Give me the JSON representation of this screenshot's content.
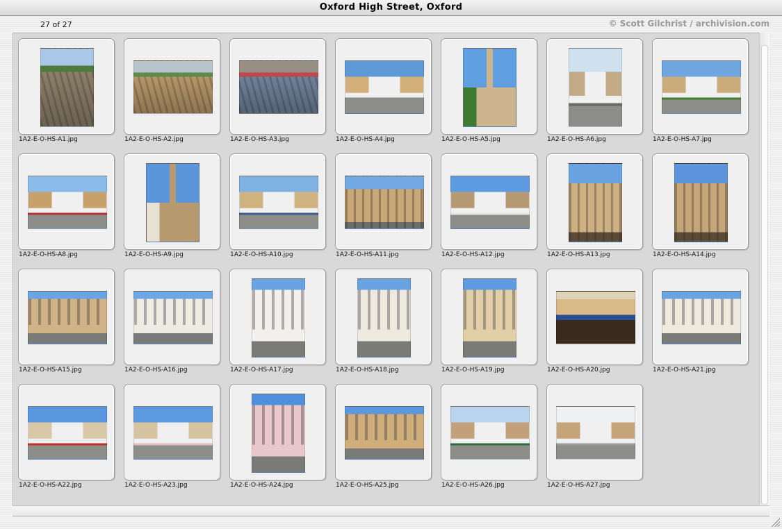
{
  "window": {
    "title": "Oxford High Street, Oxford"
  },
  "header": {
    "count": "27 of 27",
    "credit": "© Scott Gilchrist / archivision.com"
  },
  "images": [
    {
      "file": "1A2-E-O-HS-A1.jpg",
      "orientation": "p",
      "scene": "aerial-street",
      "sky": "#a9c7e6",
      "main": "#9a8c74",
      "accent": "#4f7a3c"
    },
    {
      "file": "1A2-E-O-HS-A2.jpg",
      "orientation": "l",
      "scene": "aerial-roofs",
      "sky": "#b8c4cc",
      "main": "#c9a673",
      "accent": "#5b8a49"
    },
    {
      "file": "1A2-E-O-HS-A3.jpg",
      "orientation": "l",
      "scene": "aerial-roofs",
      "sky": "#9a8f85",
      "main": "#7a8fa8",
      "accent": "#c0464a"
    },
    {
      "file": "1A2-E-O-HS-A4.jpg",
      "orientation": "l",
      "scene": "street",
      "sky": "#5e9ad8",
      "main": "#d3b07a",
      "accent": "#8a8a86"
    },
    {
      "file": "1A2-E-O-HS-A5.jpg",
      "orientation": "p",
      "scene": "spire",
      "sky": "#5f9fe0",
      "main": "#cbb48e",
      "accent": "#3f7a32"
    },
    {
      "file": "1A2-E-O-HS-A6.jpg",
      "orientation": "p",
      "scene": "street",
      "sky": "#cfe0ef",
      "main": "#c2ab86",
      "accent": "#6e6e6c"
    },
    {
      "file": "1A2-E-O-HS-A7.jpg",
      "orientation": "l",
      "scene": "street",
      "sky": "#6fa6df",
      "main": "#c9ab7c",
      "accent": "#3f7d2f"
    },
    {
      "file": "1A2-E-O-HS-A8.jpg",
      "orientation": "l",
      "scene": "street",
      "sky": "#8bbbe8",
      "main": "#c7a06b",
      "accent": "#b8323a"
    },
    {
      "file": "1A2-E-O-HS-A9.jpg",
      "orientation": "p",
      "scene": "spire",
      "sky": "#5b95da",
      "main": "#b89a70",
      "accent": "#e8e2d5"
    },
    {
      "file": "1A2-E-O-HS-A10.jpg",
      "orientation": "l",
      "scene": "street",
      "sky": "#7fb1e3",
      "main": "#cfb27f",
      "accent": "#3a5f8a"
    },
    {
      "file": "1A2-E-O-HS-A11.jpg",
      "orientation": "l",
      "scene": "building",
      "sky": "#72a9e2",
      "main": "#c8a877",
      "accent": "#6d6d6a"
    },
    {
      "file": "1A2-E-O-HS-A12.jpg",
      "orientation": "l",
      "scene": "street",
      "sky": "#5e9be0",
      "main": "#b59a73",
      "accent": "#e6e6e3"
    },
    {
      "file": "1A2-E-O-HS-A13.jpg",
      "orientation": "p",
      "scene": "building",
      "sky": "#6aa3e1",
      "main": "#cdb084",
      "accent": "#5a4a36"
    },
    {
      "file": "1A2-E-O-HS-A14.jpg",
      "orientation": "p",
      "scene": "building",
      "sky": "#5c95dc",
      "main": "#c4a67a",
      "accent": "#5a4a36"
    },
    {
      "file": "1A2-E-O-HS-A15.jpg",
      "orientation": "l",
      "scene": "facade",
      "sky": "#6aa5e3",
      "main": "#d0b386",
      "accent": "#8a8b87"
    },
    {
      "file": "1A2-E-O-HS-A16.jpg",
      "orientation": "l",
      "scene": "facade",
      "sky": "#6ea8e4",
      "main": "#efece4",
      "accent": "#c9a56c"
    },
    {
      "file": "1A2-E-O-HS-A17.jpg",
      "orientation": "p",
      "scene": "facade",
      "sky": "#6aa3e2",
      "main": "#f2f0ea",
      "accent": "#d4a03a"
    },
    {
      "file": "1A2-E-O-HS-A18.jpg",
      "orientation": "p",
      "scene": "facade",
      "sky": "#6aa3e2",
      "main": "#eeeae0",
      "accent": "#2f3a2c"
    },
    {
      "file": "1A2-E-O-HS-A19.jpg",
      "orientation": "p",
      "scene": "facade",
      "sky": "#5f9be0",
      "main": "#e2cfa8",
      "accent": "#2d4a86"
    },
    {
      "file": "1A2-E-O-HS-A20.jpg",
      "orientation": "l",
      "scene": "market",
      "sky": "#e0d4b8",
      "main": "#d8b988",
      "accent": "#2b4f94"
    },
    {
      "file": "1A2-E-O-HS-A21.jpg",
      "orientation": "l",
      "scene": "facade",
      "sky": "#69a4e3",
      "main": "#efe9de",
      "accent": "#b8323a"
    },
    {
      "file": "1A2-E-O-HS-A22.jpg",
      "orientation": "l",
      "scene": "street",
      "sky": "#5a97de",
      "main": "#d9c8a8",
      "accent": "#c0302c"
    },
    {
      "file": "1A2-E-O-HS-A23.jpg",
      "orientation": "l",
      "scene": "street",
      "sky": "#5e9ae0",
      "main": "#d6c3a0",
      "accent": "#e7b8c0"
    },
    {
      "file": "1A2-E-O-HS-A24.jpg",
      "orientation": "p",
      "scene": "facade",
      "sky": "#4f8fdc",
      "main": "#e9c8cc",
      "accent": "#7a8d9a"
    },
    {
      "file": "1A2-E-O-HS-A25.jpg",
      "orientation": "l",
      "scene": "facade",
      "sky": "#5c98df",
      "main": "#cfae7b",
      "accent": "#c0302c"
    },
    {
      "file": "1A2-E-O-HS-A26.jpg",
      "orientation": "l",
      "scene": "street",
      "sky": "#b9d4ec",
      "main": "#c2a07a",
      "accent": "#2e6a3a"
    },
    {
      "file": "1A2-E-O-HS-A27.jpg",
      "orientation": "l",
      "scene": "street",
      "sky": "#eef0f2",
      "main": "#c4a378",
      "accent": "#9a9a96"
    }
  ]
}
